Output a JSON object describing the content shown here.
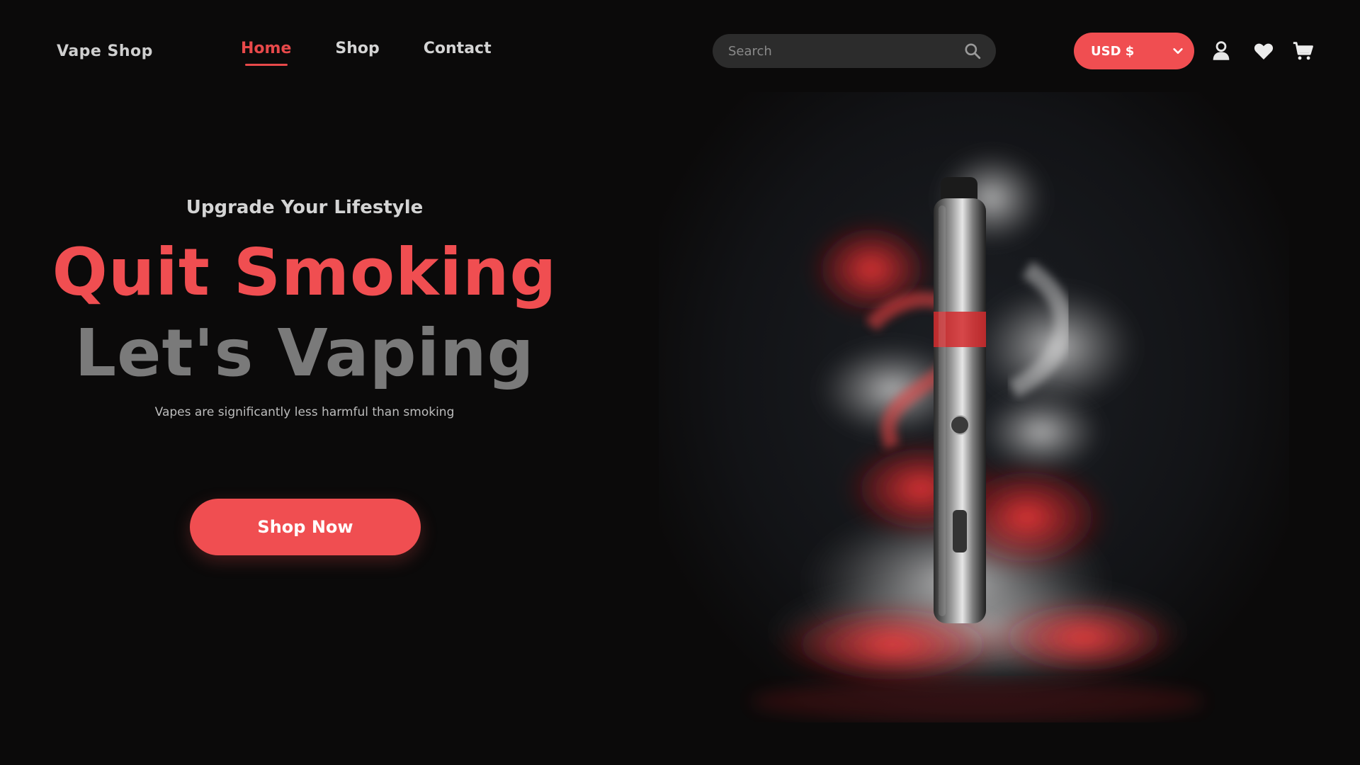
{
  "brand": {
    "name": "Vape Shop"
  },
  "nav": {
    "items": [
      {
        "label": "Home",
        "active": true
      },
      {
        "label": "Shop",
        "active": false
      },
      {
        "label": "Contact",
        "active": false
      }
    ]
  },
  "search": {
    "placeholder": "Search",
    "icon": "search-icon"
  },
  "currency": {
    "label": "USD $",
    "icon": "chevron-down-icon"
  },
  "header_icons": [
    "user-icon",
    "heart-icon",
    "cart-icon"
  ],
  "hero": {
    "tagline": "Upgrade Your Lifestyle",
    "title_line_1": "Quit Smoking",
    "title_line_2": "Let's Vaping",
    "subtext": "Vapes are significantly less harmful than smoking",
    "cta_label": "Shop Now"
  },
  "colors": {
    "background": "#0b0a0a",
    "accent": "#f04e51",
    "muted_title": "#7a7a7a",
    "search_bg": "#2c2c2c"
  }
}
